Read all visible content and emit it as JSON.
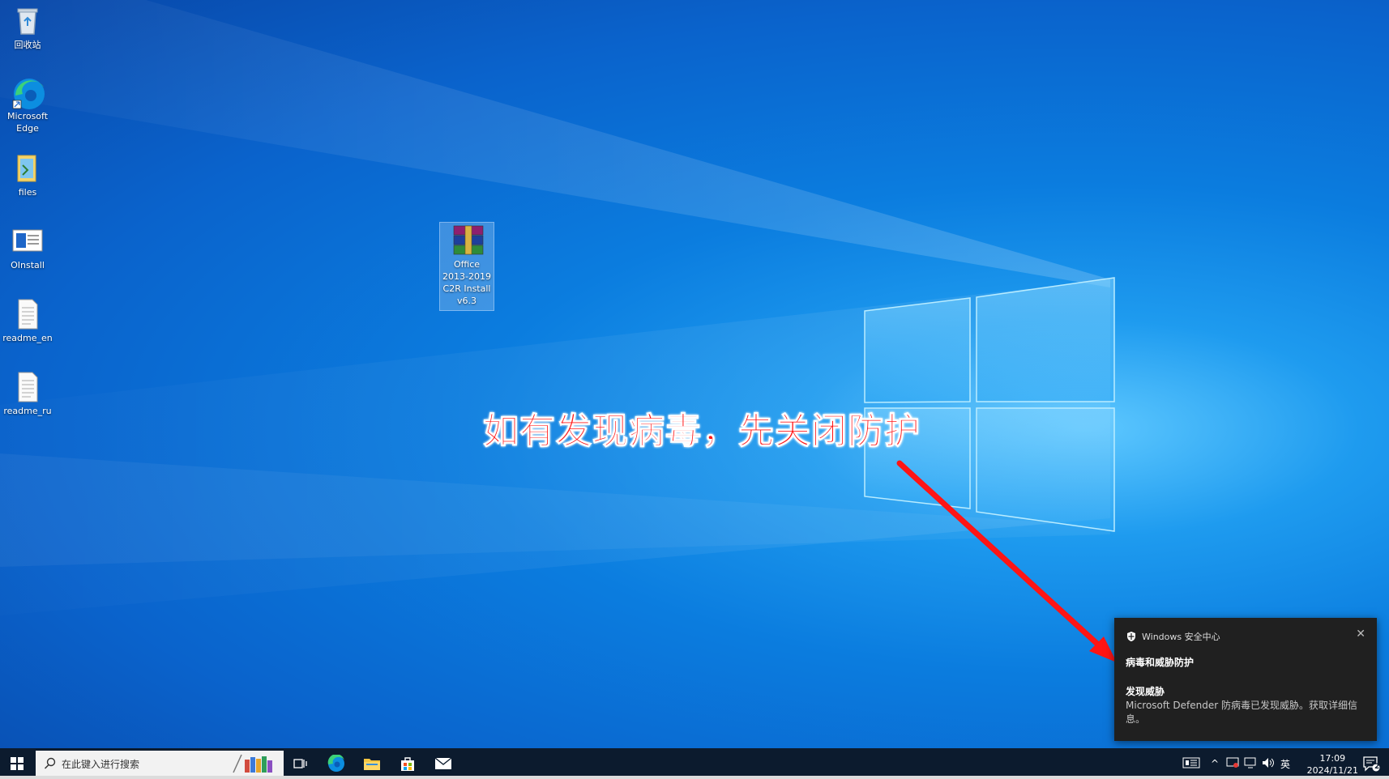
{
  "desktop": {
    "icons": [
      {
        "label": "回收站"
      },
      {
        "label": "Microsoft Edge"
      },
      {
        "label": "files"
      },
      {
        "label": "OInstall"
      },
      {
        "label": "readme_en"
      },
      {
        "label": "readme_ru"
      },
      {
        "label": "Office 2013-2019 C2R Install v6.3"
      }
    ]
  },
  "annotation": {
    "text": "如有发现病毒，先关闭防护",
    "color": "#ff1515"
  },
  "toast": {
    "app_name": "Windows 安全中心",
    "section": "病毒和威胁防护",
    "headline": "发现威胁",
    "body": "Microsoft Defender 防病毒已发现威胁。获取详细信息。",
    "close_icon": "close-icon"
  },
  "taskbar": {
    "search_placeholder": "在此键入进行搜索",
    "ime": "英",
    "time": "17:09",
    "date": "2024/11/21",
    "notification_count": "2"
  }
}
